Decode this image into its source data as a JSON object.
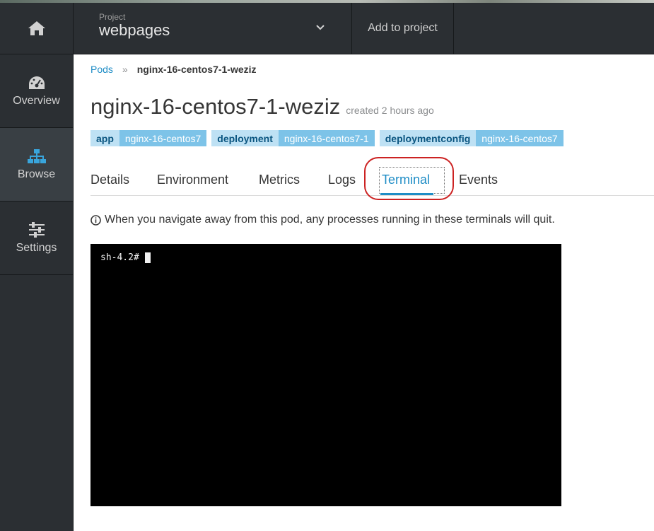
{
  "sidebar": {
    "items": [
      {
        "label": "",
        "icon": "home-icon"
      },
      {
        "label": "Overview",
        "icon": "dashboard-icon"
      },
      {
        "label": "Browse",
        "icon": "sitemap-icon"
      },
      {
        "label": "Settings",
        "icon": "sliders-icon"
      }
    ]
  },
  "topbar": {
    "project_caption": "Project",
    "project_name": "webpages",
    "add_to_project": "Add to project"
  },
  "breadcrumb": {
    "parent": "Pods",
    "separator": "»",
    "current": "nginx-16-centos7-1-weziz"
  },
  "pod": {
    "name": "nginx-16-centos7-1-weziz",
    "created": "created 2 hours ago",
    "labels": [
      {
        "key": "app",
        "value": "nginx-16-centos7"
      },
      {
        "key": "deployment",
        "value": "nginx-16-centos7-1"
      },
      {
        "key": "deploymentconfig",
        "value": "nginx-16-centos7"
      }
    ]
  },
  "tabs": [
    "Details",
    "Environment",
    "Metrics",
    "Logs",
    "Terminal",
    "Events"
  ],
  "active_tab": "Terminal",
  "info_message": "When you navigate away from this pod, any processes running in these terminals will quit.",
  "terminal": {
    "prompt": "sh-4.2#"
  },
  "colors": {
    "accent": "#1f8dc6",
    "sidebar_bg": "#2b2f33",
    "annotation": "#cc2222"
  }
}
